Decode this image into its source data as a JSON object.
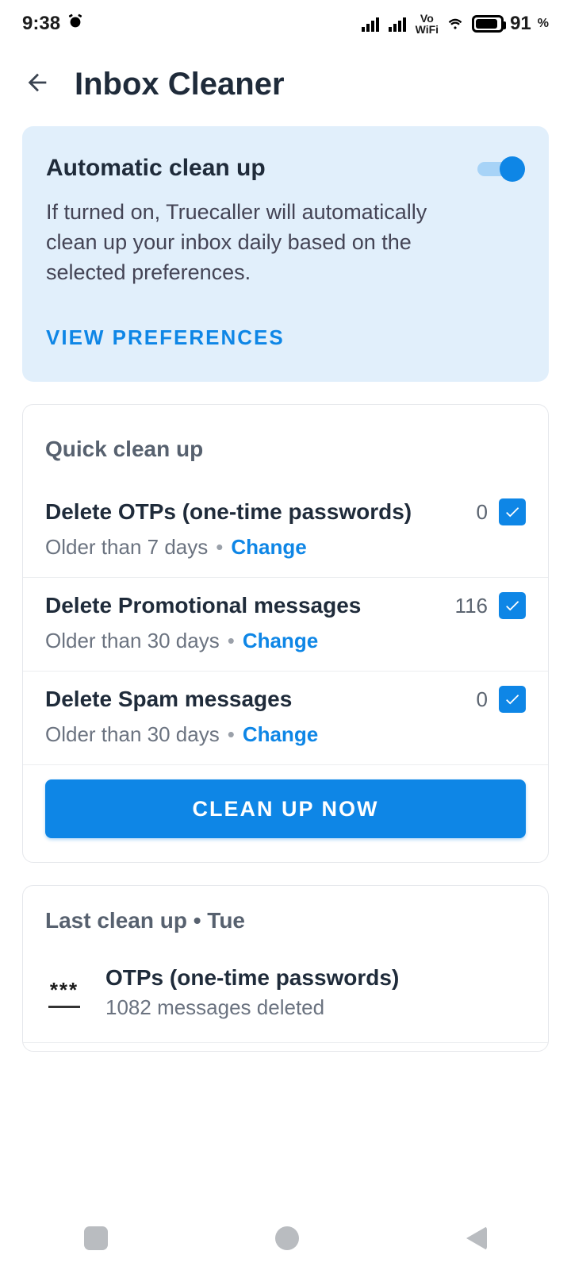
{
  "status": {
    "time": "9:38",
    "battery": "91",
    "battery_unit": "%"
  },
  "header": {
    "title": "Inbox Cleaner"
  },
  "auto": {
    "title": "Automatic clean up",
    "description": "If turned on, Truecaller will automatically clean up your inbox daily based on the selected preferences.",
    "link": "VIEW PREFERENCES",
    "enabled": true
  },
  "quick": {
    "title": "Quick clean up",
    "items": [
      {
        "title": "Delete OTPs (one-time passwords)",
        "count": "0",
        "older": "Older than 7 days",
        "change": "Change",
        "checked": true
      },
      {
        "title": "Delete Promotional messages",
        "count": "116",
        "older": "Older than 30 days",
        "change": "Change",
        "checked": true
      },
      {
        "title": "Delete Spam messages",
        "count": "0",
        "older": "Older than 30 days",
        "change": "Change",
        "checked": true
      }
    ],
    "button": "CLEAN UP NOW"
  },
  "last": {
    "title": "Last clean up • Tue",
    "results": [
      {
        "title": "OTPs (one-time passwords)",
        "subtitle": "1082 messages deleted"
      }
    ]
  }
}
